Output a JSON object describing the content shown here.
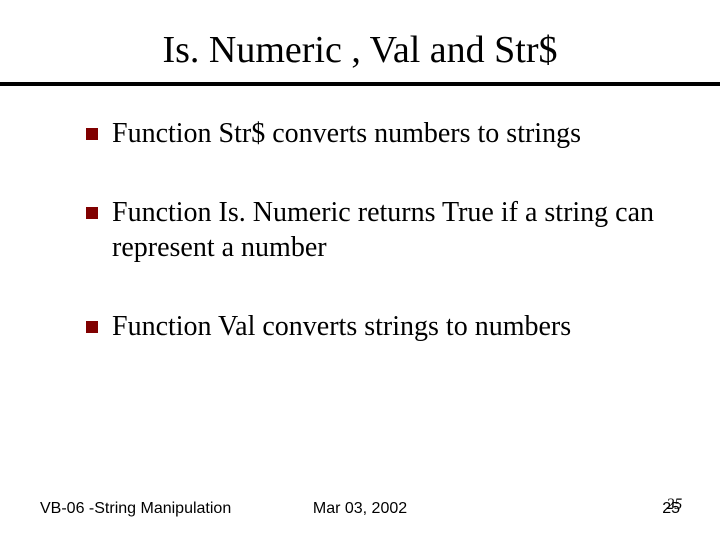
{
  "title": "Is. Numeric , Val and Str$",
  "bullets": [
    "Function Str$ converts numbers to strings",
    "Function Is. Numeric returns True if a string can represent a number",
    "Function Val converts strings to numbers"
  ],
  "footer": {
    "left": "VB-06 -String Manipulation",
    "center": "Mar 03, 2002",
    "page_a": "25",
    "page_b": "25"
  }
}
